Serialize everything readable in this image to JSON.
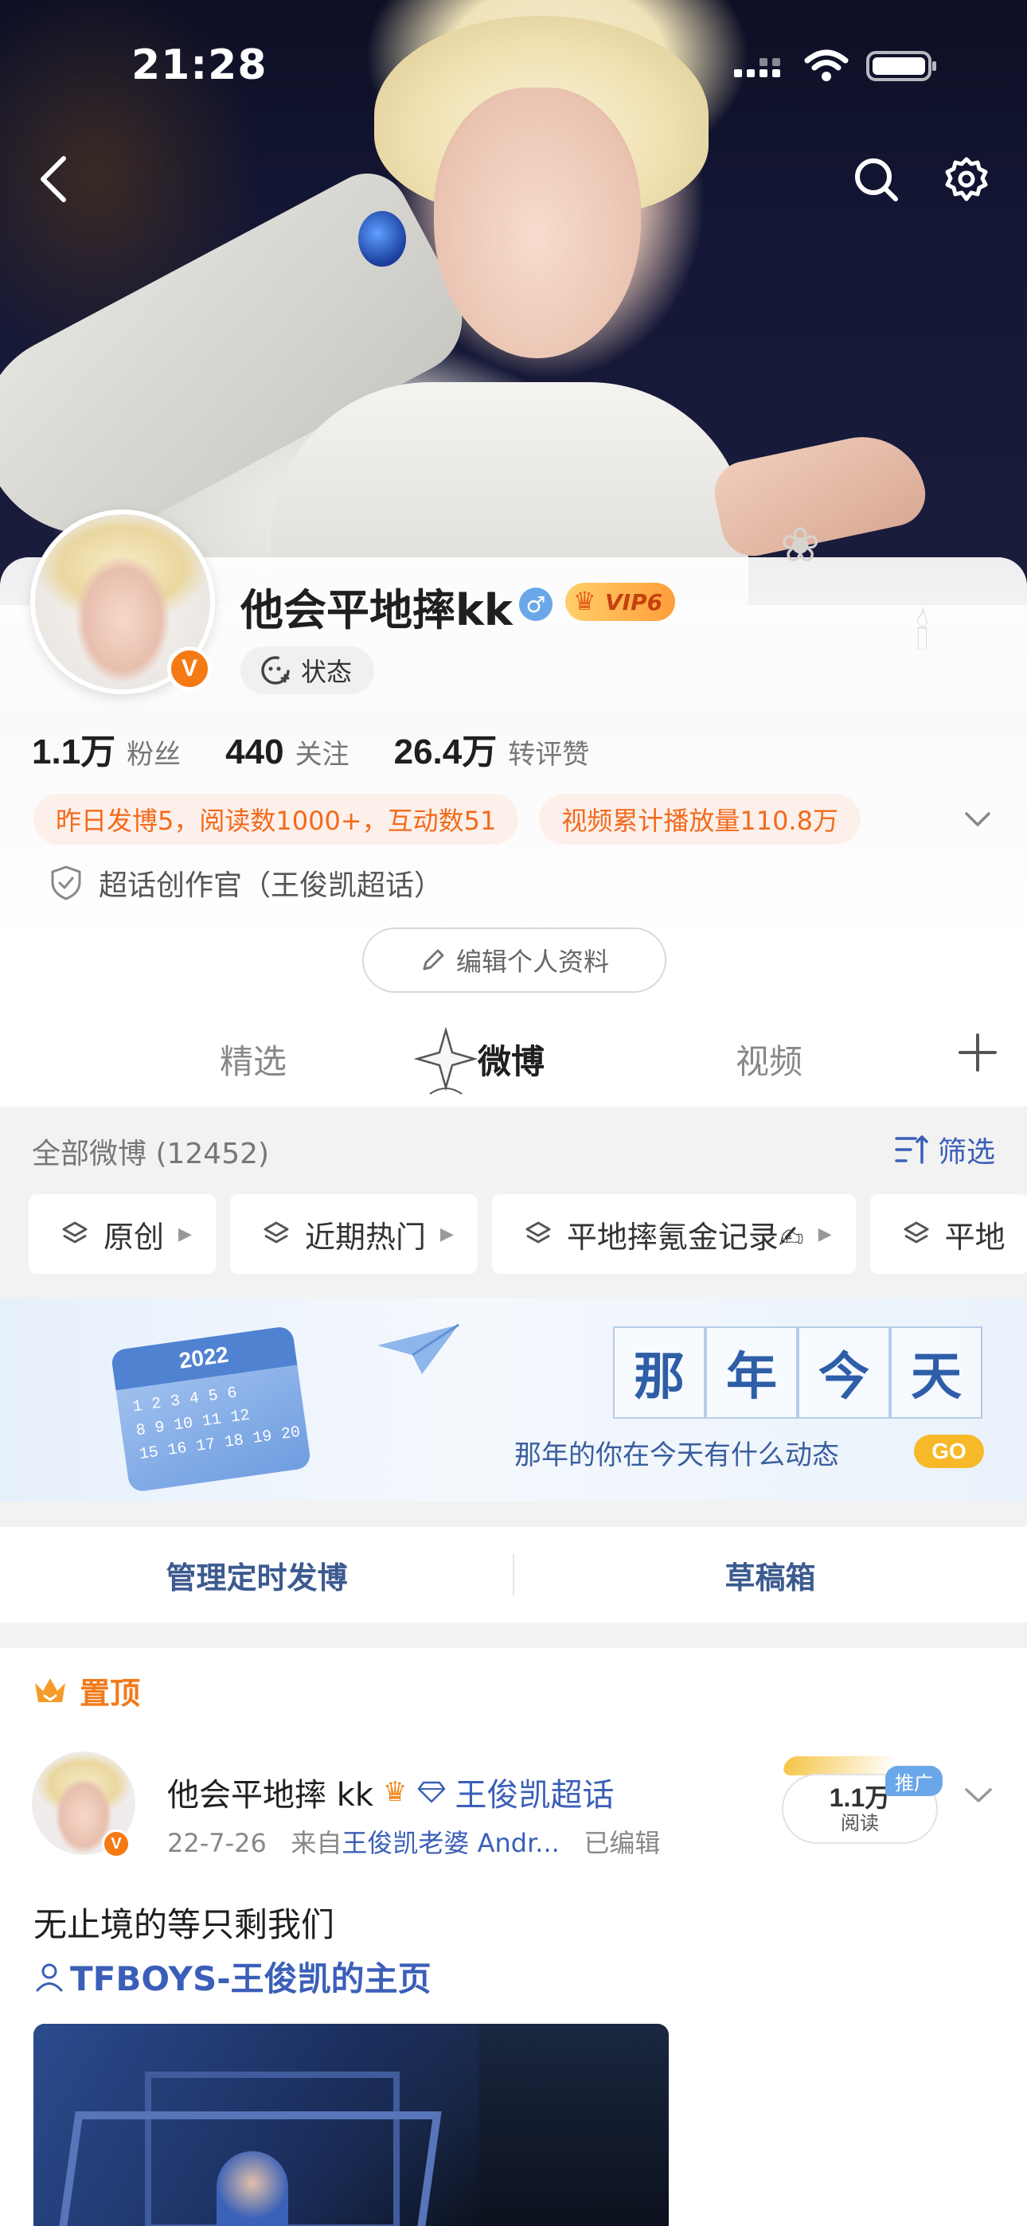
{
  "status_bar": {
    "time": "21:28"
  },
  "profile": {
    "username": "他会平地摔kk",
    "gender_symbol": "♂",
    "vip_label": "VIP6",
    "status_chip": "状态",
    "avatar_badge": "V",
    "stats": [
      {
        "value": "1.1万",
        "label": "粉丝"
      },
      {
        "value": "440",
        "label": "关注"
      },
      {
        "value": "26.4万",
        "label": "转评赞"
      }
    ],
    "pills": [
      "昨日发博5，阅读数1000+，互动数51",
      "视频累计播放量110.8万"
    ],
    "super_topic_role": "超话创作官（王俊凯超话）",
    "edit_button": "编辑个人资料"
  },
  "tabs": {
    "items": [
      "精选",
      "微博",
      "视频"
    ],
    "active": "微博"
  },
  "feed": {
    "all_weibo": "全部微博 (12452)",
    "filter_label": "筛选",
    "chips": [
      "原创",
      "近期热门",
      "平地摔氪金记录✍",
      "平地"
    ]
  },
  "banner": {
    "calendar_year": "2022",
    "calendar_rows": [
      "1 2 3 4 5 6",
      "8 9 10 11 12",
      "15 16 17 18 19 20"
    ],
    "title_chars": [
      "那",
      "年",
      "今",
      "天"
    ],
    "subtitle": "那年的你在今天有什么动态",
    "go": "GO"
  },
  "manage": {
    "scheduled": "管理定时发博",
    "drafts": "草稿箱"
  },
  "post": {
    "pinned_label": "置顶",
    "author": "他会平地摔 kk",
    "topic": "王俊凯超话",
    "date": "22-7-26",
    "source_prefix": "来自",
    "source": "王俊凯老婆 Andr...",
    "edited": "已编辑",
    "reads_value": "1.1万",
    "reads_label": "阅读",
    "promo_tag": "推广",
    "text": "无止境的等只剩我们",
    "link": "TFBOYS-王俊凯的主页"
  },
  "colors": {
    "brand_orange": "#f57a14",
    "link_blue": "#3b5fb8",
    "pill_text": "#f26a1c",
    "go_yellow": "#f7b92a"
  }
}
